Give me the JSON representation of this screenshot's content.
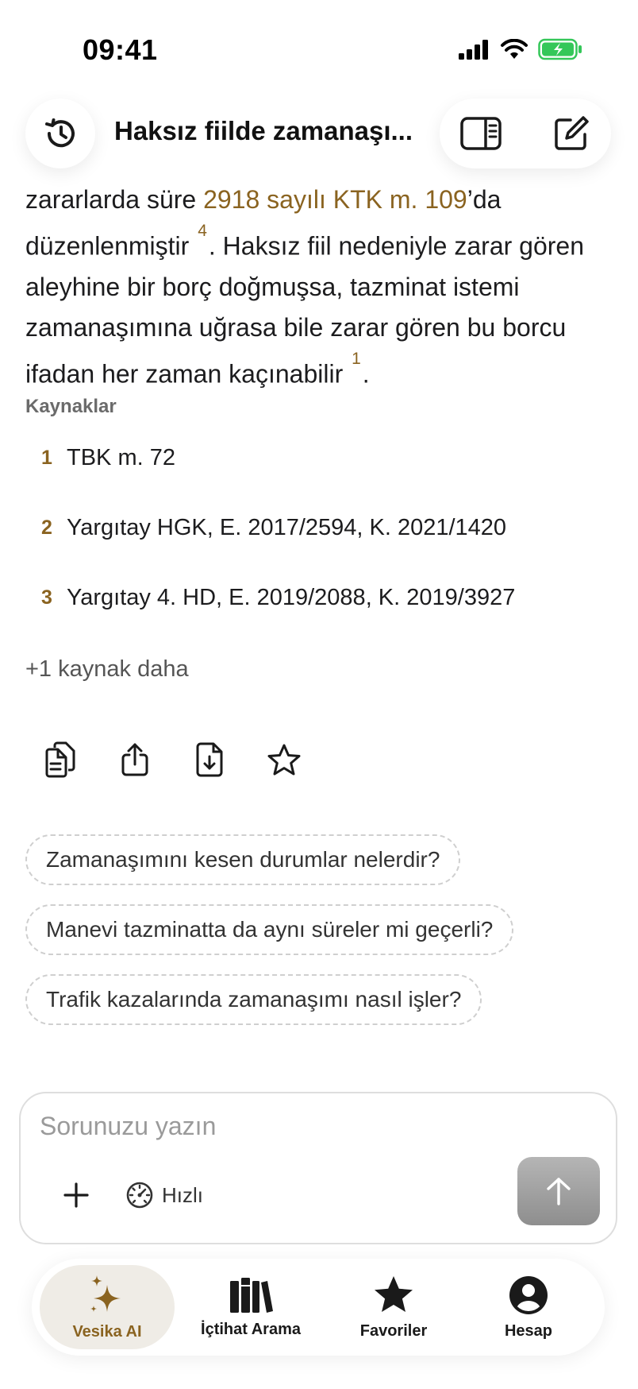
{
  "status_bar": {
    "time": "09:41"
  },
  "header": {
    "title": "Haksız fiilde zamanaşı..."
  },
  "answer": {
    "line_prefix": "zararlarda süre ",
    "law_link": "2918 sayılı KTK m. 109",
    "line_suffix": "’da düzenlenmiştir ",
    "cite_a": "4",
    "text_b": ". Haksız fiil nedeniyle zarar gören aleyhine bir borç doğmuşsa, tazminat istemi zamanaşımına uğrasa bile zarar gören bu borcu ifadan her zaman kaçınabilir ",
    "cite_b": "1",
    "text_end": "."
  },
  "sources": {
    "title": "Kaynaklar",
    "items": [
      {
        "num": "1",
        "text": "TBK m. 72"
      },
      {
        "num": "2",
        "text": "Yargıtay HGK, E. 2017/2594, K. 2021/1420"
      },
      {
        "num": "3",
        "text": "Yargıtay 4. HD, E. 2019/2088, K. 2019/3927"
      }
    ],
    "more": "+1 kaynak daha"
  },
  "actions": [
    "copy-icon",
    "share-icon",
    "download-icon",
    "star-icon"
  ],
  "suggestions": [
    "Zamanaşımını kesen durumlar nelerdir?",
    "Manevi tazminatta da aynı süreler mi geçerli?",
    "Trafik kazalarında zamanaşımı nasıl işler?"
  ],
  "composer": {
    "placeholder": "Sorunuzu yazın",
    "mode_label": "Hızlı"
  },
  "tabs": [
    {
      "label": "Vesika AI",
      "icon": "sparkles-icon",
      "active": true
    },
    {
      "label": "İçtihat Arama",
      "icon": "books-icon",
      "active": false
    },
    {
      "label": "Favoriler",
      "icon": "star-icon",
      "active": false
    },
    {
      "label": "Hesap",
      "icon": "account-icon",
      "active": false
    }
  ],
  "colors": {
    "accent": "#8a6320",
    "battery": "#34c759",
    "active_tab_bg": "#efece6"
  }
}
